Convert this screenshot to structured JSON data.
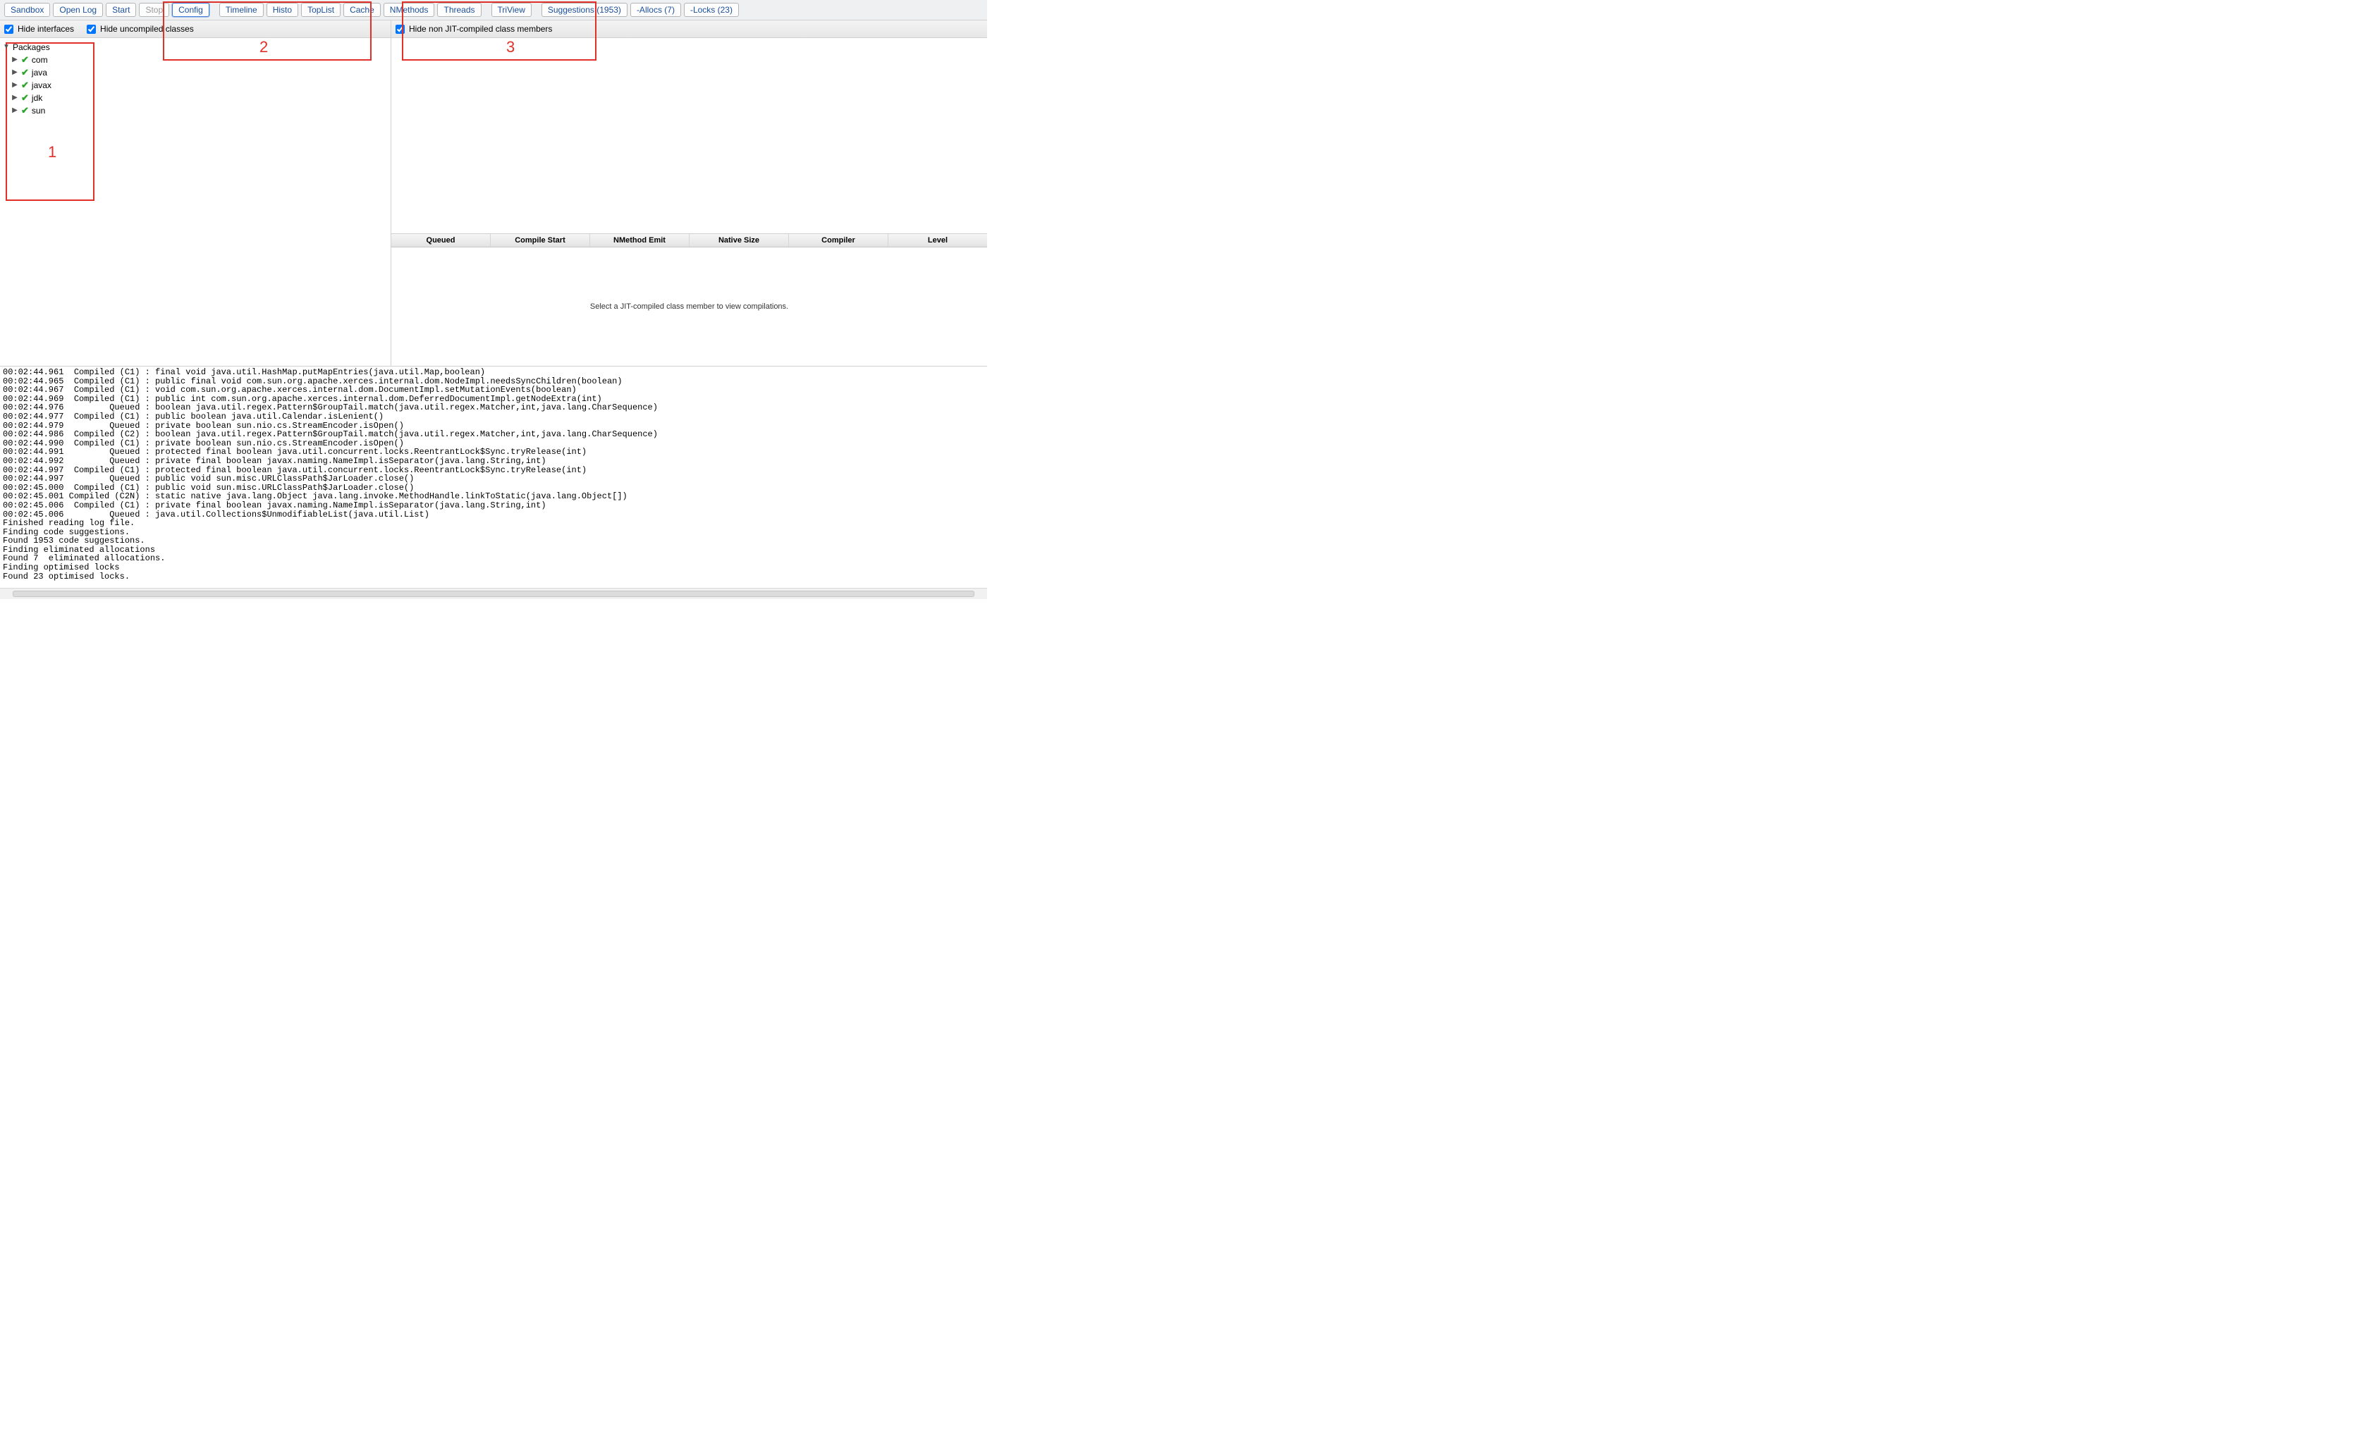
{
  "toolbar": {
    "sandbox": "Sandbox",
    "open_log": "Open Log",
    "start": "Start",
    "stop": "Stop",
    "config": "Config",
    "timeline": "Timeline",
    "histo": "Histo",
    "toplist": "TopList",
    "cache": "Cache",
    "nmethods": "NMethods",
    "threads": "Threads",
    "triview": "TriView",
    "suggestions": "Suggestions (1953)",
    "allocs": "-Allocs (7)",
    "locks": "-Locks (23)"
  },
  "filters": {
    "hide_interfaces": "Hide interfaces",
    "hide_uncompiled": "Hide uncompiled classes",
    "hide_non_jit": "Hide non JIT-compiled class members"
  },
  "tree": {
    "root": "Packages",
    "items": [
      "com",
      "java",
      "javax",
      "jdk",
      "sun"
    ]
  },
  "table": {
    "headers": [
      "Queued",
      "Compile Start",
      "NMethod Emit",
      "Native Size",
      "Compiler",
      "Level"
    ],
    "empty_msg": "Select a JIT-compiled class member to view compilations."
  },
  "annotations": {
    "a1": "1",
    "a2": "2",
    "a3": "3"
  },
  "log_lines": [
    "00:02:44.961  Compiled (C1) : final void java.util.HashMap.putMapEntries(java.util.Map,boolean)",
    "00:02:44.965  Compiled (C1) : public final void com.sun.org.apache.xerces.internal.dom.NodeImpl.needsSyncChildren(boolean)",
    "00:02:44.967  Compiled (C1) : void com.sun.org.apache.xerces.internal.dom.DocumentImpl.setMutationEvents(boolean)",
    "00:02:44.969  Compiled (C1) : public int com.sun.org.apache.xerces.internal.dom.DeferredDocumentImpl.getNodeExtra(int)",
    "00:02:44.976         Queued : boolean java.util.regex.Pattern$GroupTail.match(java.util.regex.Matcher,int,java.lang.CharSequence)",
    "00:02:44.977  Compiled (C1) : public boolean java.util.Calendar.isLenient()",
    "00:02:44.979         Queued : private boolean sun.nio.cs.StreamEncoder.isOpen()",
    "00:02:44.986  Compiled (C2) : boolean java.util.regex.Pattern$GroupTail.match(java.util.regex.Matcher,int,java.lang.CharSequence)",
    "00:02:44.990  Compiled (C1) : private boolean sun.nio.cs.StreamEncoder.isOpen()",
    "00:02:44.991         Queued : protected final boolean java.util.concurrent.locks.ReentrantLock$Sync.tryRelease(int)",
    "00:02:44.992         Queued : private final boolean javax.naming.NameImpl.isSeparator(java.lang.String,int)",
    "00:02:44.997  Compiled (C1) : protected final boolean java.util.concurrent.locks.ReentrantLock$Sync.tryRelease(int)",
    "00:02:44.997         Queued : public void sun.misc.URLClassPath$JarLoader.close()",
    "00:02:45.000  Compiled (C1) : public void sun.misc.URLClassPath$JarLoader.close()",
    "00:02:45.001 Compiled (C2N) : static native java.lang.Object java.lang.invoke.MethodHandle.linkToStatic(java.lang.Object[])",
    "00:02:45.006  Compiled (C1) : private final boolean javax.naming.NameImpl.isSeparator(java.lang.String,int)",
    "00:02:45.006         Queued : java.util.Collections$UnmodifiableList(java.util.List)",
    "Finished reading log file.",
    "Finding code suggestions.",
    "Found 1953 code suggestions.",
    "Finding eliminated allocations",
    "Found 7  eliminated allocations.",
    "Finding optimised locks",
    "Found 23 optimised locks."
  ]
}
